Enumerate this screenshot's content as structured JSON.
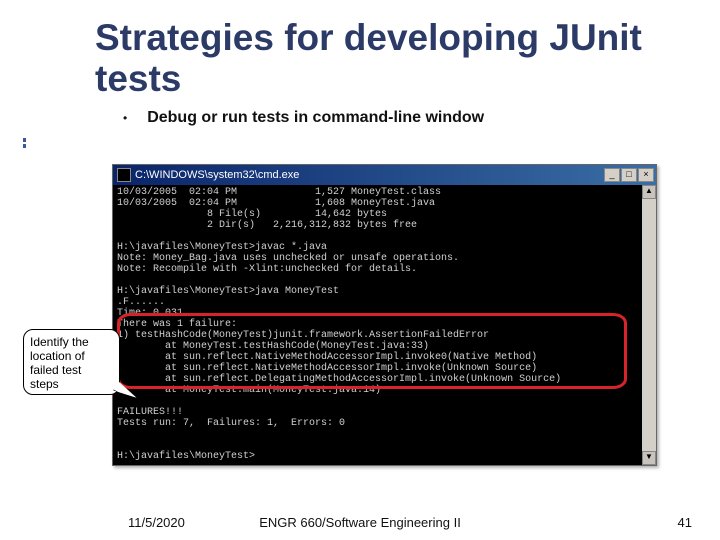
{
  "slide": {
    "title": "Strategies for developing JUnit tests",
    "bullet": "Debug or run tests in command-line window"
  },
  "callout": {
    "text": "Identify the location of failed test steps"
  },
  "cmd": {
    "title": "C:\\WINDOWS\\system32\\cmd.exe",
    "lines": {
      "l0": "10/03/2005  02:04 PM             1,527 MoneyTest.class",
      "l1": "10/03/2005  02:04 PM             1,608 MoneyTest.java",
      "l2": "               8 File(s)         14,642 bytes",
      "l3": "               2 Dir(s)   2,216,312,832 bytes free",
      "l4": "",
      "l5": "H:\\javafiles\\MoneyTest>javac *.java",
      "l6": "Note: Money_Bag.java uses unchecked or unsafe operations.",
      "l7": "Note: Recompile with -Xlint:unchecked for details.",
      "l8": "",
      "l9": "H:\\javafiles\\MoneyTest>java MoneyTest",
      "l10": ".F......",
      "l11": "Time: 0.031",
      "l12": "There was 1 failure:",
      "l13": "1) testHashCode(MoneyTest)junit.framework.AssertionFailedError",
      "l14": "        at MoneyTest.testHashCode(MoneyTest.java:33)",
      "l15": "        at sun.reflect.NativeMethodAccessorImpl.invoke0(Native Method)",
      "l16": "        at sun.reflect.NativeMethodAccessorImpl.invoke(Unknown Source)",
      "l17": "        at sun.reflect.DelegatingMethodAccessorImpl.invoke(Unknown Source)",
      "l18": "        at MoneyTest.main(MoneyTest.java:14)",
      "l19": "",
      "l20": "FAILURES!!!",
      "l21": "Tests run: 7,  Failures: 1,  Errors: 0",
      "l22": "",
      "l23": "",
      "l24": "H:\\javafiles\\MoneyTest>"
    },
    "btn_min": "_",
    "btn_max": "□",
    "btn_close": "×",
    "scroll_up": "▲",
    "scroll_down": "▼"
  },
  "footer": {
    "date": "11/5/2020",
    "course": "ENGR 660/Software Engineering II",
    "page": "41"
  }
}
